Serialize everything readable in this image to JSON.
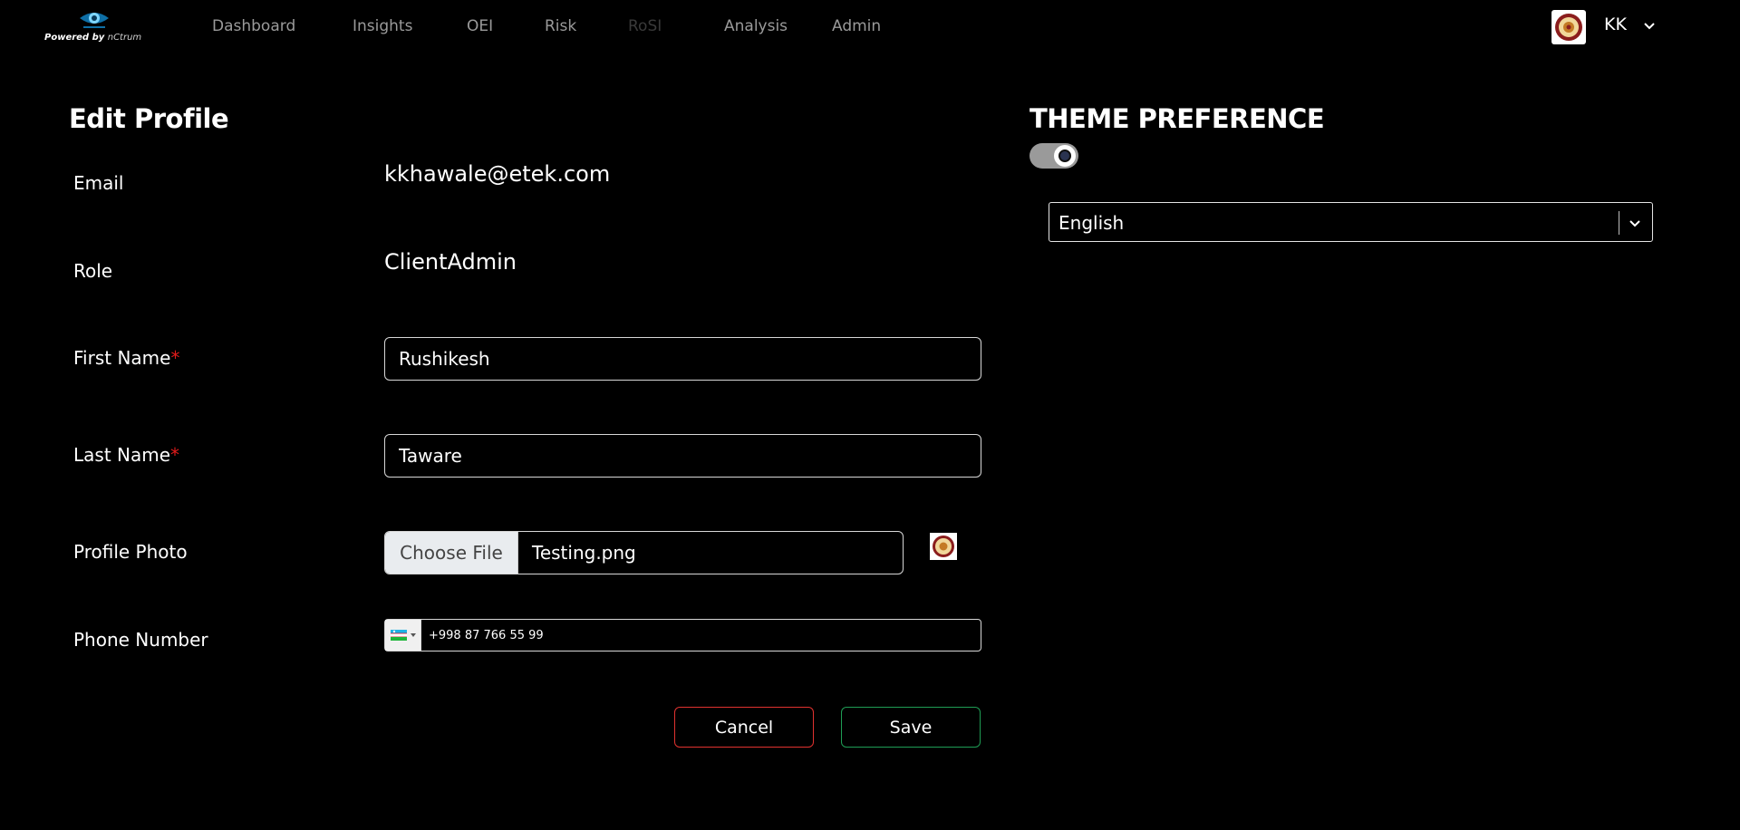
{
  "header": {
    "logo": {
      "powered_by": "Powered by",
      "brand": "nCtrum"
    },
    "nav": [
      {
        "label": "Dashboard",
        "state": "normal"
      },
      {
        "label": "Insights",
        "state": "normal"
      },
      {
        "label": "OEI",
        "state": "normal"
      },
      {
        "label": "Risk",
        "state": "normal"
      },
      {
        "label": "RoSI",
        "state": "disabled"
      },
      {
        "label": "Analysis",
        "state": "normal"
      },
      {
        "label": "Admin",
        "state": "normal"
      }
    ],
    "user": {
      "initials": "KK",
      "icon": "chevron-down-icon"
    }
  },
  "profile": {
    "title": "Edit Profile",
    "email": {
      "label": "Email",
      "value": "kkhawale@etek.com"
    },
    "role": {
      "label": "Role",
      "value": "ClientAdmin"
    },
    "first_name": {
      "label": "First Name",
      "required_mark": "*",
      "value": "Rushikesh"
    },
    "last_name": {
      "label": "Last Name",
      "required_mark": "*",
      "value": "Taware"
    },
    "photo": {
      "label": "Profile Photo",
      "button": "Choose File",
      "file_name": "Testing.png"
    },
    "phone": {
      "label": "Phone Number",
      "value": "+998 87 766 55 99",
      "flag_icon": "uzbekistan-flag-icon"
    },
    "cancel_label": "Cancel",
    "save_label": "Save"
  },
  "theme": {
    "title": "THEME PREFERENCE",
    "toggle_on": true,
    "language": "English"
  },
  "colors": {
    "background": "#000000",
    "required": "#e21b1b",
    "cancel_border": "#e0322f",
    "save_border": "#1f9d55",
    "nav_text": "#9a9a9a"
  }
}
